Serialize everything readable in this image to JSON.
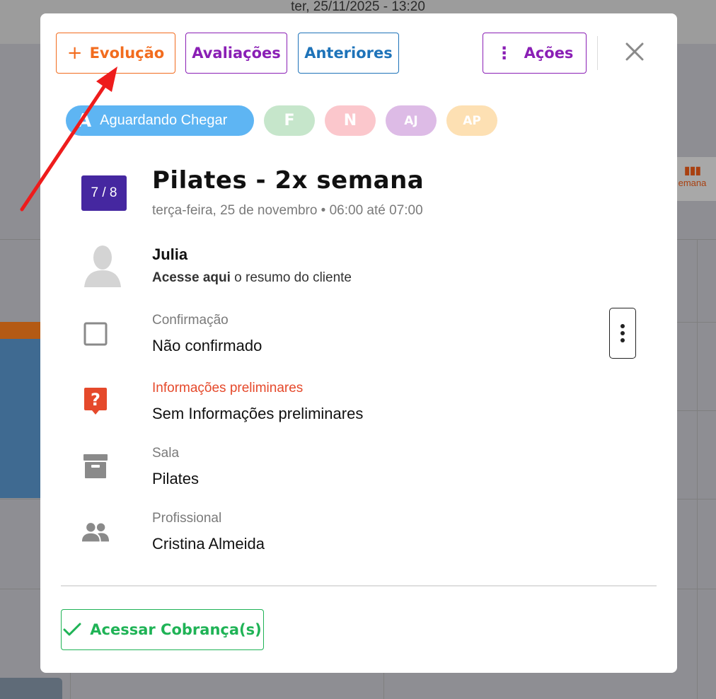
{
  "background": {
    "datetime": "ter, 25/11/2025 - 13:20",
    "week_label": "emana"
  },
  "toolbar": {
    "evolucao_label": "Evolução",
    "avaliacoes_label": "Avaliações",
    "anteriores_label": "Anteriores",
    "acoes_label": "Ações"
  },
  "tags": [
    {
      "letter": "A",
      "label": "Aguardando Chegar",
      "color": "#5eb5f3"
    },
    {
      "letter": "F",
      "color": "#c6e6cb"
    },
    {
      "letter": "N",
      "color": "#fbc7cc"
    },
    {
      "letter": "AJ",
      "color": "#ddbbe6"
    },
    {
      "letter": "AP",
      "color": "#fde0b3"
    }
  ],
  "session": {
    "count": "7 / 8",
    "title": "Pilates - 2x semana",
    "subtitle": "terça-feira, 25 de novembro • 06:00 até 07:00"
  },
  "client": {
    "name": "Julia",
    "link_bold": "Acesse aqui",
    "link_rest": " o resumo do cliente"
  },
  "details": {
    "confirmacao_label": "Confirmação",
    "confirmacao_value": "Não confirmado",
    "info_label": "Informações preliminares",
    "info_value": "Sem Informações preliminares",
    "sala_label": "Sala",
    "sala_value": "Pilates",
    "profissional_label": "Profissional",
    "profissional_value": "Cristina Almeida"
  },
  "footer": {
    "cobranca_label": "Acessar Cobrança(s)"
  },
  "colors": {
    "evolucao": "#f26c1e",
    "avaliacoes": "#8a1fb5",
    "anteriores": "#1e73b9",
    "cobranca": "#1fb356",
    "annotation_arrow": "#ee1c1c"
  }
}
